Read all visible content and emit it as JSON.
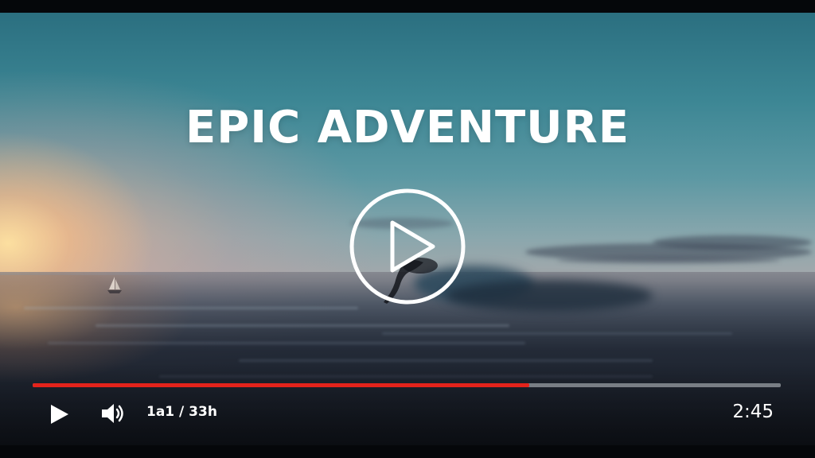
{
  "video": {
    "title": "EPIC ADVENTURE",
    "progress_fraction": 0.664
  },
  "controls": {
    "play_icon": "play-icon",
    "volume_icon": "volume-icon",
    "time_readout": "1a1 / 33h",
    "duration": "2:45"
  },
  "colors": {
    "progress_fill": "#e3231b",
    "progress_track": "#c8cdd2",
    "text": "#ffffff"
  }
}
